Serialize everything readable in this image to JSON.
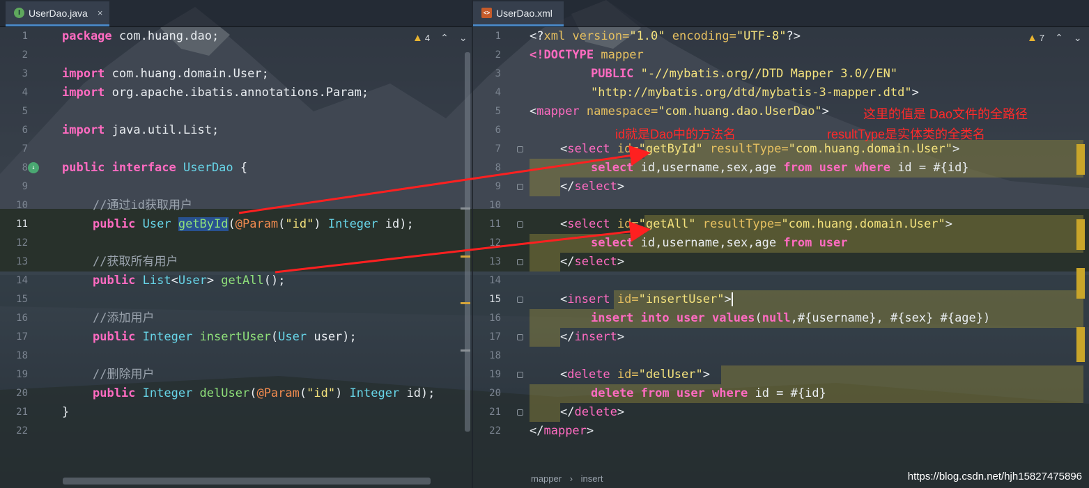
{
  "tabs": {
    "left": {
      "title": "UserDao.java",
      "icon": "java-interface-icon",
      "close": "×"
    },
    "right": {
      "title": "UserDao.xml",
      "icon": "xml-file-icon"
    }
  },
  "warnings": {
    "left": "4",
    "right": "7"
  },
  "line_numbers": [
    "1",
    "2",
    "3",
    "4",
    "5",
    "6",
    "7",
    "8",
    "9",
    "10",
    "11",
    "12",
    "13",
    "14",
    "15",
    "16",
    "17",
    "18",
    "19",
    "20",
    "21",
    "22"
  ],
  "java": {
    "l1": {
      "kw": "package",
      "rest": " com.huang.dao;"
    },
    "l3": {
      "kw": "import",
      "rest": " com.huang.domain.User;"
    },
    "l4": {
      "kw": "import",
      "rest": " org.apache.ibatis.annotations.Param;"
    },
    "l6": {
      "kw": "import",
      "rest": " java.util.List;"
    },
    "l8": {
      "kw": "public interface",
      "name": " UserDao",
      "rest": " {"
    },
    "l10": {
      "comment": "//通过id获取用户"
    },
    "l11": {
      "kw": "public",
      "type": " User ",
      "fn": "getById",
      "p1": "(",
      "an": "@Param",
      "p2": "(",
      "str": "\"id\"",
      "p3": ") ",
      "type2": "Integer",
      "p4": " id);"
    },
    "l13": {
      "comment": "//获取所有用户"
    },
    "l14": {
      "kw": "public",
      "type": " List",
      "p1": "<",
      "type2": "User",
      "p2": "> ",
      "fn": "getAll",
      "p3": "();"
    },
    "l16": {
      "comment": "//添加用户"
    },
    "l17": {
      "kw": "public",
      "type": " Integer ",
      "fn": "insertUser",
      "p1": "(",
      "type2": "User",
      "p2": " user);"
    },
    "l19": {
      "comment": "//删除用户"
    },
    "l20": {
      "kw": "public",
      "type": " Integer ",
      "fn": "delUser",
      "p1": "(",
      "an": "@Param",
      "p2": "(",
      "str": "\"id\"",
      "p3": ") ",
      "type2": "Integer",
      "p4": " id);"
    },
    "l21": {
      "rest": "}"
    }
  },
  "xml": {
    "l1": {
      "a": "<?",
      "b": "xml",
      "c": " version=",
      "d": "\"1.0\"",
      "e": " encoding=",
      "f": "\"UTF-8\"",
      "g": "?>"
    },
    "l2": {
      "a": "<!DOCTYPE",
      "b": " mapper"
    },
    "l3": {
      "a": "PUBLIC ",
      "b": "\"-//mybatis.org//DTD Mapper 3.0//EN\""
    },
    "l4": {
      "a": "\"http://mybatis.org/dtd/mybatis-3-mapper.dtd\"",
      "b": ">"
    },
    "l5": {
      "a": "<",
      "b": "mapper",
      "c": " namespace=",
      "d": "\"com.huang.dao.UserDao\"",
      "e": ">"
    },
    "l7": {
      "a": "<",
      "b": "select",
      "c": " id=",
      "d": "\"getById\"",
      "e": " resultType=",
      "f": "\"com.huang.domain.User\"",
      "g": ">"
    },
    "l8": {
      "a": "select",
      "b": " id,username,sex,age ",
      "c": "from",
      "d": " ",
      "e": "user",
      "f": " ",
      "g": "where",
      "h": " id = #{id}"
    },
    "l9": {
      "a": "</",
      "b": "select",
      "c": ">"
    },
    "l11": {
      "a": "<",
      "b": "select",
      "c": " id=",
      "d": "\"getAll\"",
      "e": " resultType=",
      "f": "\"com.huang.domain.User\"",
      "g": ">"
    },
    "l12": {
      "a": "select",
      "b": " id,username,sex,age ",
      "c": "from",
      "d": " ",
      "e": "user"
    },
    "l13": {
      "a": "</",
      "b": "select",
      "c": ">"
    },
    "l15": {
      "a": "<",
      "b": "insert",
      "c": " id=",
      "d": "\"insertUser\"",
      "e": ">"
    },
    "l16": {
      "a": "insert into",
      "b": " ",
      "c": "user",
      "d": " ",
      "e": "values",
      "f": "(",
      "g": "null",
      "h": ",#{username}, #{sex} #{age})"
    },
    "l17": {
      "a": "</",
      "b": "insert",
      "c": ">"
    },
    "l19": {
      "a": "<",
      "b": "delete",
      "c": " id=",
      "d": "\"delUser\"",
      "e": ">"
    },
    "l20": {
      "a": "delete from",
      "b": " ",
      "c": "user",
      "d": " ",
      "e": "where",
      "f": " id = #{id}"
    },
    "l21": {
      "a": "</",
      "b": "delete",
      "c": ">"
    },
    "l22": {
      "a": "</",
      "b": "mapper",
      "c": ">"
    }
  },
  "annotations": {
    "a1": "这里的值是 Dao文件的全路径",
    "a2": "id就是Dao中的方法名",
    "a3": "resultType是实体类的全类名",
    "color": "#ff2a2a"
  },
  "breadcrumb": {
    "a": "mapper",
    "sep": "›",
    "b": "insert"
  },
  "watermark": "https://blog.csdn.net/hjh15827475896"
}
